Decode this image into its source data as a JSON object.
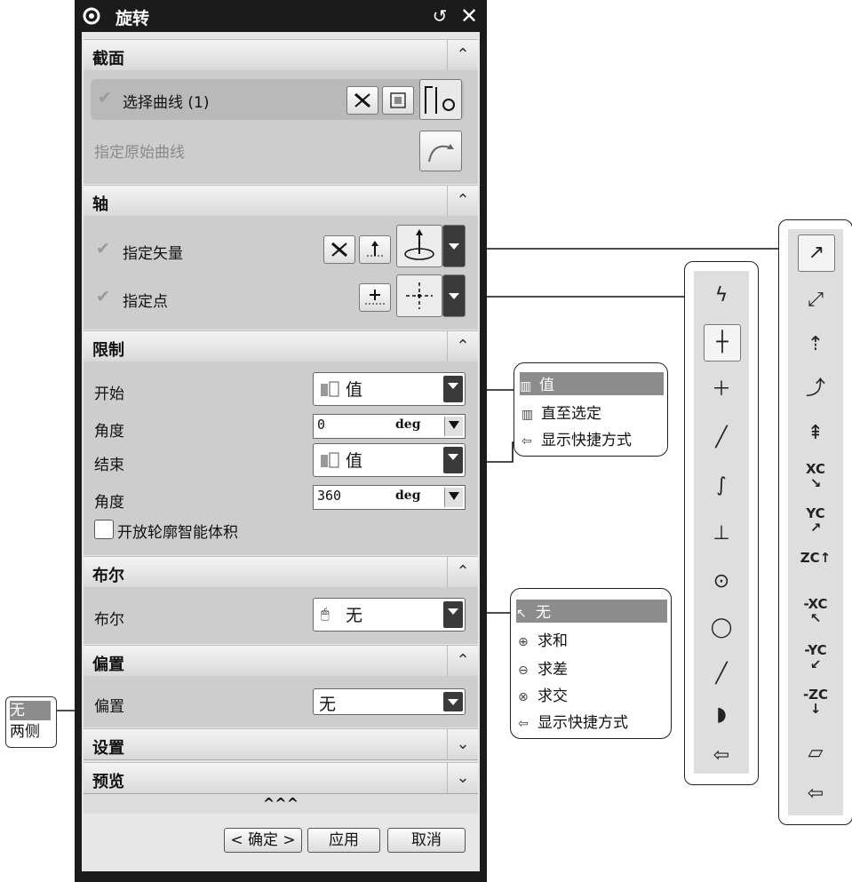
{
  "dialog": {
    "title": "旋转",
    "sections": {
      "section": {
        "label": "截面",
        "select_curve": "选择曲线 (1)",
        "specify_original": "指定原始曲线"
      },
      "axis": {
        "label": "轴",
        "specify_vector": "指定矢量",
        "specify_point": "指定点"
      },
      "limits": {
        "label": "限制",
        "start_label": "开始",
        "start_value": "值",
        "angle1_label": "角度",
        "angle1_value": "0",
        "unit1": "deg",
        "end_label": "结束",
        "end_value": "值",
        "angle2_label": "角度",
        "angle2_value": "360",
        "unit2": "deg",
        "open_profile": "开放轮廓智能体积"
      },
      "boolean": {
        "label": "布尔",
        "field_label": "布尔",
        "value": "无"
      },
      "offset": {
        "label": "偏置",
        "field_label": "偏置",
        "value": "无"
      },
      "settings": {
        "label": "设置"
      },
      "preview": {
        "label": "预览"
      }
    },
    "more": "^^^",
    "ok": "< 确定 >",
    "apply": "应用",
    "cancel": "取消"
  },
  "limit_popup": {
    "items": [
      "值",
      "直至选定",
      "显示快捷方式"
    ]
  },
  "boolean_popup": {
    "items": [
      "无",
      "求和",
      "求差",
      "求交",
      "显示快捷方式"
    ]
  },
  "offset_popup": {
    "items": [
      "无",
      "两侧"
    ]
  },
  "vector_palette": {
    "labels": [
      "XC",
      "YC",
      "ZC",
      "-XC",
      "-YC",
      "-ZC"
    ]
  }
}
